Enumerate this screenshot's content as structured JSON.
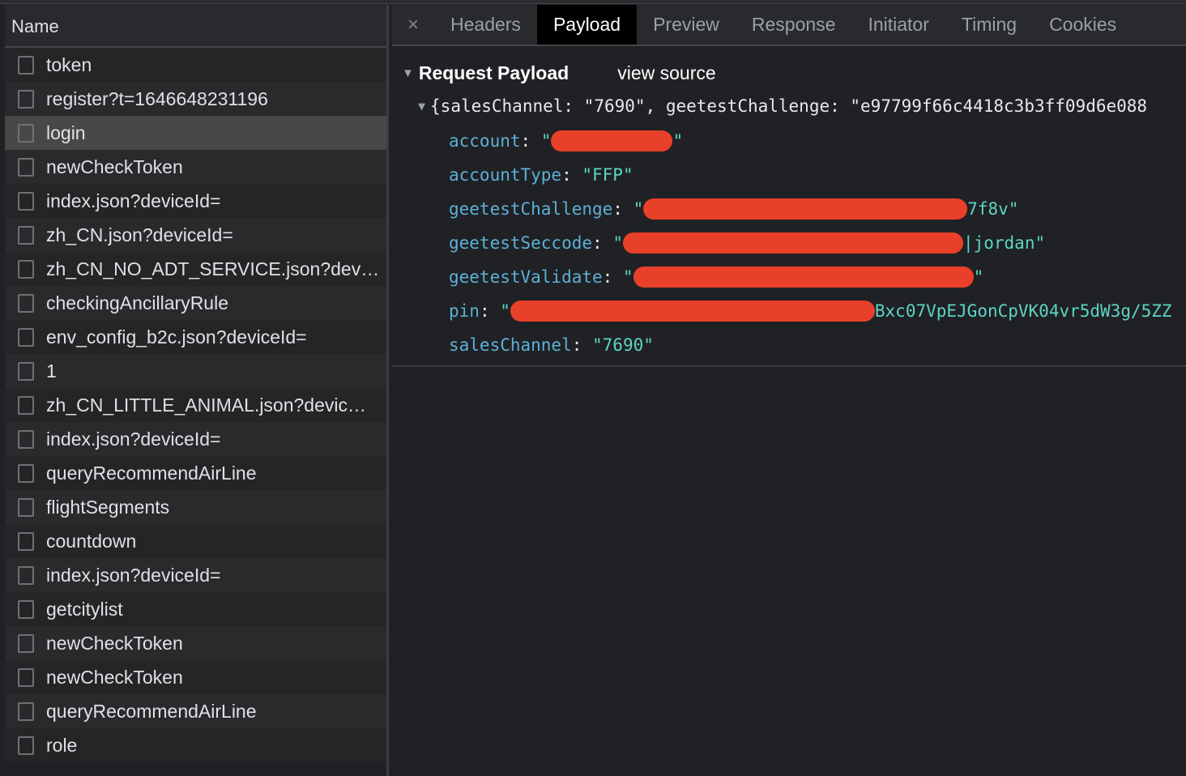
{
  "left": {
    "header": "Name",
    "rows": [
      {
        "name": "token"
      },
      {
        "name": "register?t=1646648231196"
      },
      {
        "name": "login",
        "selected": true
      },
      {
        "name": "newCheckToken"
      },
      {
        "name": "index.json?deviceId="
      },
      {
        "name": "zh_CN.json?deviceId="
      },
      {
        "name": "zh_CN_NO_ADT_SERVICE.json?dev…"
      },
      {
        "name": "checkingAncillaryRule"
      },
      {
        "name": "env_config_b2c.json?deviceId="
      },
      {
        "name": "1"
      },
      {
        "name": "zh_CN_LITTLE_ANIMAL.json?devic…"
      },
      {
        "name": "index.json?deviceId="
      },
      {
        "name": "queryRecommendAirLine"
      },
      {
        "name": "flightSegments"
      },
      {
        "name": "countdown"
      },
      {
        "name": "index.json?deviceId="
      },
      {
        "name": "getcitylist"
      },
      {
        "name": "newCheckToken"
      },
      {
        "name": "newCheckToken"
      },
      {
        "name": "queryRecommendAirLine"
      },
      {
        "name": "role"
      }
    ]
  },
  "tabs": {
    "close": "×",
    "items": [
      "Headers",
      "Payload",
      "Preview",
      "Response",
      "Initiator",
      "Timing",
      "Cookies"
    ],
    "active": "Payload"
  },
  "payload": {
    "title": "Request Payload",
    "view_source": "view source",
    "summary": "{salesChannel: \"7690\", geetestChallenge: \"e97799f66c4418c3b3ff09d6e088",
    "props": [
      {
        "key": "account",
        "prefix": "\"",
        "redacted": true,
        "suffix": "\""
      },
      {
        "key": "accountType",
        "prefix": "\"FFP\"",
        "redacted": false,
        "suffix": ""
      },
      {
        "key": "geetestChallenge",
        "prefix": "\"",
        "redacted": true,
        "suffix": "7f8v\""
      },
      {
        "key": "geetestSeccode",
        "prefix": "\"",
        "redacted": true,
        "suffix": "|jordan\""
      },
      {
        "key": "geetestValidate",
        "prefix": "\"",
        "redacted": true,
        "suffix": "\""
      },
      {
        "key": "pin",
        "prefix": "\"",
        "redacted": true,
        "suffix": "Bxc07VpEJGonCpVK04vr5dW3g/5ZZ"
      },
      {
        "key": "salesChannel",
        "prefix": "\"7690\"",
        "redacted": false,
        "suffix": ""
      }
    ]
  },
  "colors": {
    "redaction": "#e8402a",
    "key": "#5db0d7",
    "string": "#5cd5c5"
  }
}
